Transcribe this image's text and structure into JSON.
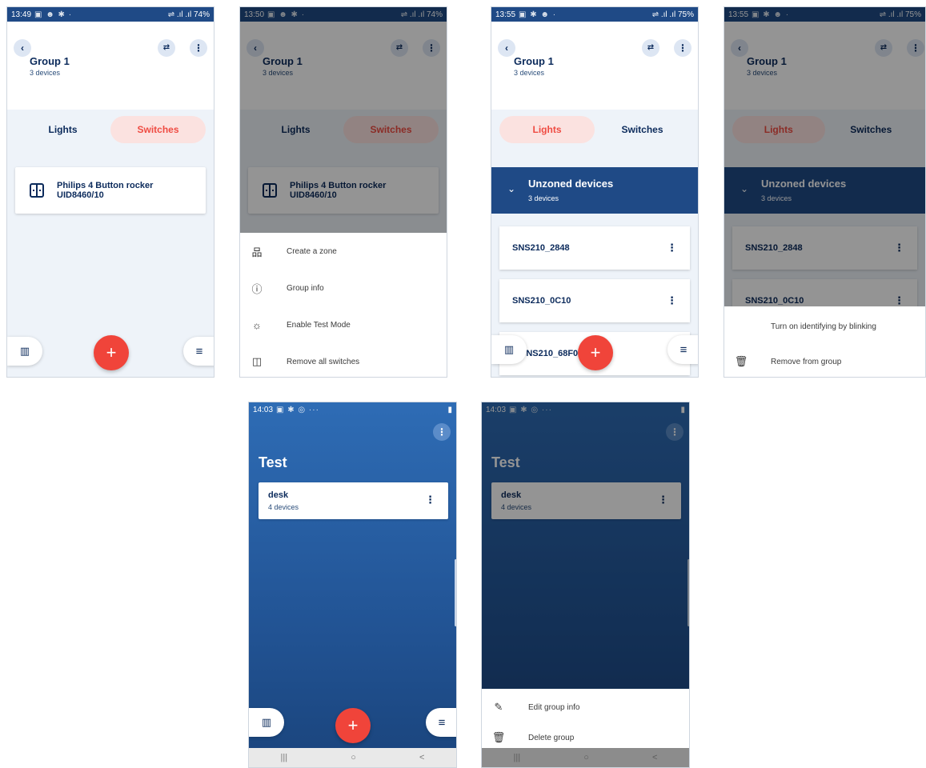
{
  "screen1": {
    "time": "13:49",
    "status_icons": "▣ ☻ ✱ ·",
    "right_status": "⇌ .ıl .ıl 74%",
    "group": {
      "title": "Group 1",
      "subtitle": "3 devices"
    },
    "tabs": [
      "Lights",
      "Switches"
    ],
    "device": {
      "line1": "Philips 4 Button rocker",
      "line2": "UID8460/10"
    },
    "fab": "+"
  },
  "screen2": {
    "time": "13:50",
    "status_icons": "▣ ☻ ✱ ·",
    "right_status": "⇌ .ıl .ıl 74%",
    "group": {
      "title": "Group 1",
      "subtitle": "3 devices"
    },
    "tabs": [
      "Lights",
      "Switches"
    ],
    "device": {
      "line1": "Philips 4 Button rocker",
      "line2": "UID8460/10"
    },
    "menu": [
      "Create a zone",
      "Group info",
      "Enable Test Mode",
      "Remove all switches"
    ]
  },
  "screen3": {
    "time": "13:55",
    "status_icons": "▣ ✱ ☻ ·",
    "right_status": "⇌ .ıl .ıl 75%",
    "group": {
      "title": "Group 1",
      "subtitle": "3 devices"
    },
    "tabs": [
      "Lights",
      "Switches"
    ],
    "zone": {
      "title": "Unzoned devices",
      "subtitle": "3 devices"
    },
    "devices": [
      "SNS210_2848",
      "SNS210_0C10",
      "SNS210_68F0"
    ],
    "fab": "+"
  },
  "screen4": {
    "time": "13:55",
    "status_icons": "▣ ✱ ☻ ·",
    "right_status": "⇌ .ıl .ıl 75%",
    "group": {
      "title": "Group 1",
      "subtitle": "3 devices"
    },
    "tabs": [
      "Lights",
      "Switches"
    ],
    "zone": {
      "title": "Unzoned devices",
      "subtitle": "3 devices"
    },
    "devices": [
      "SNS210_2848",
      "SNS210_0C10"
    ],
    "menu": [
      "Turn on identifying by blinking",
      "Remove from group"
    ]
  },
  "screen5": {
    "time": "14:03",
    "status_icons": "▣ ✱ ◎ ···",
    "title": "Test",
    "card": {
      "title": "desk",
      "subtitle": "4 devices"
    },
    "fab": "+",
    "nav": [
      "|||",
      "○",
      "<"
    ]
  },
  "screen6": {
    "time": "14:03",
    "status_icons": "▣ ✱ ◎ ···",
    "title": "Test",
    "card": {
      "title": "desk",
      "subtitle": "4 devices"
    },
    "menu": [
      "Edit group info",
      "Delete group"
    ],
    "nav": [
      "|||",
      "○",
      "<"
    ]
  }
}
